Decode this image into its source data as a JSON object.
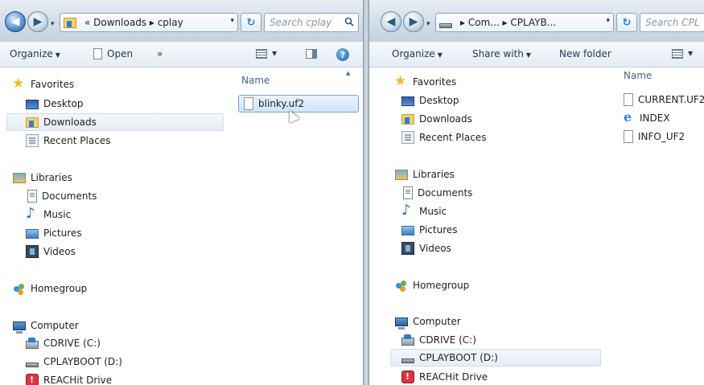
{
  "left": {
    "address": "« Downloads ▸ cplay",
    "search_placeholder": "Search cplay",
    "toolbar": {
      "organize": "Organize",
      "open": "Open",
      "more": "»"
    },
    "column_header": "Name",
    "file": "blinky.uf2",
    "nav": {
      "favorites": "Favorites",
      "desktop": "Desktop",
      "downloads": "Downloads",
      "recent_places": "Recent Places",
      "libraries": "Libraries",
      "documents": "Documents",
      "music": "Music",
      "pictures": "Pictures",
      "videos": "Videos",
      "homegroup": "Homegroup",
      "computer": "Computer",
      "cdrive": "CDRIVE (C:)",
      "cplayboot": "CPLAYBOOT (D:)",
      "reachit": "REACHit Drive"
    }
  },
  "right": {
    "address": "▸ Com... ▸ CPLAYB...",
    "search_placeholder": "Search CPL",
    "toolbar": {
      "organize": "Organize",
      "share_with": "Share with",
      "new_folder": "New folder"
    },
    "column_header": "Name",
    "files": [
      "CURRENT.UF2",
      "INDEX",
      "INFO_UF2"
    ],
    "nav": {
      "favorites": "Favorites",
      "desktop": "Desktop",
      "downloads": "Downloads",
      "recent_places": "Recent Places",
      "libraries": "Libraries",
      "documents": "Documents",
      "music": "Music",
      "pictures": "Pictures",
      "videos": "Videos",
      "homegroup": "Homegroup",
      "computer": "Computer",
      "cdrive": "CDRIVE (C:)",
      "cplayboot": "CPLAYBOOT (D:)",
      "reachit": "REACHit Drive"
    }
  }
}
